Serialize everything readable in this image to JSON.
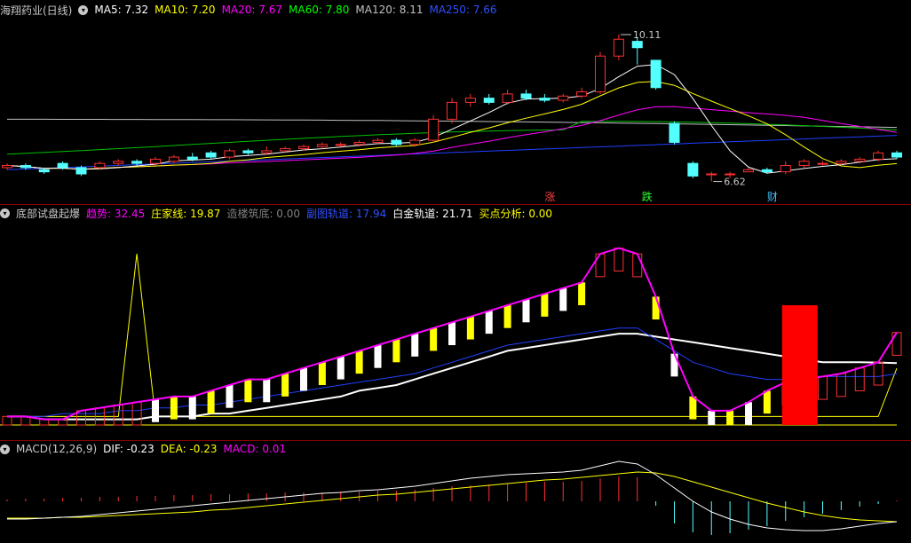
{
  "main_panel": {
    "stock_title": "海翔药业(日线)",
    "indicators": [
      {
        "label": "MA5: 7.32",
        "color": "#ffffff"
      },
      {
        "label": "MA10: 7.20",
        "color": "#ffff00"
      },
      {
        "label": "MA20: 7.67",
        "color": "#ff00ff"
      },
      {
        "label": "MA60: 7.80",
        "color": "#00ff00"
      },
      {
        "label": "MA120: 8.11",
        "color": "#c0c0c0"
      },
      {
        "label": "MA250: 7.66",
        "color": "#3050ff"
      }
    ],
    "high_label": "10.11",
    "low_label": "6.62",
    "markers": [
      "涨",
      "跌",
      "财"
    ]
  },
  "mid_panel": {
    "title": "底部试盘起爆",
    "indicators": [
      {
        "label": "趋势: 32.45",
        "color": "#ff00ff"
      },
      {
        "label": "庄家线: 19.87",
        "color": "#ffff00"
      },
      {
        "label": "造楼筑底: 0.00",
        "color": "#808080"
      },
      {
        "label": "副图轨道: 17.94",
        "color": "#3050ff"
      },
      {
        "label": "白金轨道: 21.71",
        "color": "#ffffff"
      },
      {
        "label": "买点分析: 0.00",
        "color": "#ffff00"
      }
    ]
  },
  "macd_panel": {
    "title": "MACD(12,26,9)",
    "indicators": [
      {
        "label": "DIF: -0.23",
        "color": "#ffffff"
      },
      {
        "label": "DEA: -0.23",
        "color": "#ffff00"
      },
      {
        "label": "MACD: 0.01",
        "color": "#ff00ff"
      }
    ]
  },
  "chart_data": {
    "type": "candlestick",
    "bars": 49,
    "candles": [
      [
        6.95,
        7.0,
        7.05,
        6.9
      ],
      [
        7.0,
        6.95,
        7.05,
        6.9
      ],
      [
        6.9,
        6.85,
        6.95,
        6.8
      ],
      [
        7.05,
        6.95,
        7.1,
        6.9
      ],
      [
        6.95,
        6.8,
        7.0,
        6.75
      ],
      [
        6.95,
        7.05,
        7.1,
        6.9
      ],
      [
        7.05,
        7.1,
        7.15,
        7.0
      ],
      [
        7.1,
        7.05,
        7.15,
        7.0
      ],
      [
        7.05,
        7.15,
        7.2,
        7.0
      ],
      [
        7.1,
        7.2,
        7.25,
        7.05
      ],
      [
        7.2,
        7.15,
        7.3,
        7.1
      ],
      [
        7.3,
        7.2,
        7.35,
        7.15
      ],
      [
        7.2,
        7.35,
        7.4,
        7.15
      ],
      [
        7.35,
        7.3,
        7.4,
        7.25
      ],
      [
        7.3,
        7.35,
        7.45,
        7.25
      ],
      [
        7.35,
        7.4,
        7.45,
        7.3
      ],
      [
        7.4,
        7.45,
        7.5,
        7.35
      ],
      [
        7.45,
        7.5,
        7.55,
        7.4
      ],
      [
        7.5,
        7.5,
        7.55,
        7.45
      ],
      [
        7.5,
        7.55,
        7.6,
        7.45
      ],
      [
        7.55,
        7.6,
        7.65,
        7.5
      ],
      [
        7.6,
        7.5,
        7.65,
        7.45
      ],
      [
        7.5,
        7.6,
        7.65,
        7.45
      ],
      [
        7.6,
        8.1,
        8.2,
        7.55
      ],
      [
        8.1,
        8.5,
        8.6,
        8.0
      ],
      [
        8.5,
        8.6,
        8.7,
        8.4
      ],
      [
        8.6,
        8.5,
        8.7,
        8.45
      ],
      [
        8.5,
        8.7,
        8.8,
        8.45
      ],
      [
        8.7,
        8.6,
        8.8,
        8.55
      ],
      [
        8.6,
        8.55,
        8.7,
        8.5
      ],
      [
        8.55,
        8.65,
        8.7,
        8.5
      ],
      [
        8.65,
        8.75,
        8.85,
        8.6
      ],
      [
        8.75,
        9.6,
        9.7,
        8.7
      ],
      [
        9.6,
        10.0,
        10.11,
        9.5
      ],
      [
        9.95,
        9.8,
        10.05,
        9.4
      ],
      [
        9.5,
        8.85,
        9.5,
        8.8
      ],
      [
        8.0,
        7.55,
        8.05,
        7.5
      ],
      [
        7.05,
        6.75,
        7.1,
        6.7
      ],
      [
        6.8,
        6.8,
        6.85,
        6.62
      ],
      [
        6.8,
        6.8,
        6.85,
        6.7
      ],
      [
        6.85,
        6.9,
        6.95,
        6.85
      ],
      [
        6.9,
        6.85,
        6.95,
        6.8
      ],
      [
        6.85,
        7.0,
        7.1,
        6.8
      ],
      [
        7.0,
        7.1,
        7.15,
        6.95
      ],
      [
        7.05,
        7.05,
        7.1,
        7.0
      ],
      [
        7.05,
        7.1,
        7.15,
        7.0
      ],
      [
        7.1,
        7.15,
        7.2,
        7.05
      ],
      [
        7.15,
        7.3,
        7.35,
        7.1
      ],
      [
        7.3,
        7.2,
        7.35,
        7.15
      ]
    ],
    "ma5_last": 7.32,
    "ma10_last": 7.2,
    "ma20_last": 7.67,
    "ma60_last": 7.8,
    "ma120_last": 8.11,
    "ma250_last": 7.66,
    "trend": [
      3,
      3,
      2,
      2,
      5,
      6,
      7,
      8,
      9,
      10,
      10,
      12,
      14,
      16,
      16,
      18,
      20,
      22,
      24,
      26,
      28,
      30,
      32,
      34,
      36,
      38,
      40,
      42,
      44,
      46,
      48,
      50,
      60,
      62,
      60,
      45,
      25,
      10,
      5,
      5,
      8,
      12,
      15,
      16,
      17,
      18,
      20,
      22,
      32.45
    ],
    "dealer": [
      3,
      3,
      3,
      3,
      3,
      3,
      3,
      60,
      3,
      3,
      3,
      3,
      3,
      3,
      3,
      3,
      3,
      3,
      3,
      3,
      3,
      3,
      3,
      3,
      3,
      3,
      3,
      3,
      3,
      3,
      3,
      3,
      3,
      3,
      3,
      3,
      3,
      3,
      3,
      3,
      3,
      3,
      3,
      3,
      3,
      3,
      3,
      3,
      19.87
    ],
    "sub_track": [
      3,
      3,
      3,
      4,
      4,
      4,
      5,
      5,
      6,
      6,
      7,
      7,
      8,
      9,
      10,
      11,
      12,
      13,
      14,
      15,
      16,
      17,
      18,
      20,
      22,
      24,
      26,
      28,
      29,
      30,
      31,
      32,
      33,
      34,
      34,
      30,
      26,
      22,
      20,
      18,
      17,
      16,
      16,
      16,
      17,
      17,
      17,
      17,
      17.94
    ],
    "platinum_track": [
      3,
      3,
      2,
      2,
      2,
      2,
      2,
      2,
      3,
      3,
      3,
      4,
      4,
      5,
      6,
      7,
      8,
      9,
      10,
      12,
      13,
      14,
      16,
      18,
      20,
      22,
      24,
      26,
      27,
      28,
      29,
      30,
      31,
      32,
      32,
      31,
      30,
      29,
      28,
      27,
      26,
      25,
      24,
      23,
      22,
      22,
      22,
      21.9,
      21.71
    ],
    "buy_signal_bar": 42,
    "macd_hist": [
      0.02,
      0.03,
      0.03,
      0.04,
      0.04,
      0.05,
      0.05,
      0.06,
      0.06,
      0.07,
      0.07,
      0.08,
      0.08,
      0.09,
      0.09,
      0.1,
      0.1,
      0.1,
      0.11,
      0.11,
      0.12,
      0.12,
      0.13,
      0.15,
      0.17,
      0.18,
      0.19,
      0.2,
      0.21,
      0.22,
      0.22,
      0.23,
      0.26,
      0.28,
      0.27,
      -0.05,
      -0.25,
      -0.35,
      -0.38,
      -0.36,
      -0.32,
      -0.28,
      -0.22,
      -0.18,
      -0.14,
      -0.1,
      -0.06,
      -0.03,
      0.01
    ],
    "dif": [
      -0.2,
      -0.2,
      -0.19,
      -0.18,
      -0.17,
      -0.15,
      -0.13,
      -0.11,
      -0.09,
      -0.07,
      -0.05,
      -0.03,
      -0.01,
      0.01,
      0.03,
      0.05,
      0.07,
      0.09,
      0.1,
      0.12,
      0.13,
      0.15,
      0.17,
      0.2,
      0.23,
      0.26,
      0.28,
      0.3,
      0.31,
      0.32,
      0.33,
      0.35,
      0.4,
      0.45,
      0.42,
      0.3,
      0.15,
      0.0,
      -0.12,
      -0.2,
      -0.26,
      -0.3,
      -0.32,
      -0.33,
      -0.33,
      -0.31,
      -0.28,
      -0.25,
      -0.23
    ],
    "dea": [
      -0.19,
      -0.19,
      -0.19,
      -0.18,
      -0.18,
      -0.17,
      -0.16,
      -0.15,
      -0.14,
      -0.13,
      -0.12,
      -0.1,
      -0.09,
      -0.07,
      -0.05,
      -0.03,
      -0.01,
      0.01,
      0.03,
      0.05,
      0.07,
      0.08,
      0.1,
      0.12,
      0.14,
      0.16,
      0.18,
      0.2,
      0.22,
      0.24,
      0.25,
      0.27,
      0.29,
      0.31,
      0.33,
      0.32,
      0.28,
      0.22,
      0.16,
      0.1,
      0.04,
      -0.02,
      -0.07,
      -0.12,
      -0.16,
      -0.19,
      -0.21,
      -0.22,
      -0.23
    ]
  }
}
